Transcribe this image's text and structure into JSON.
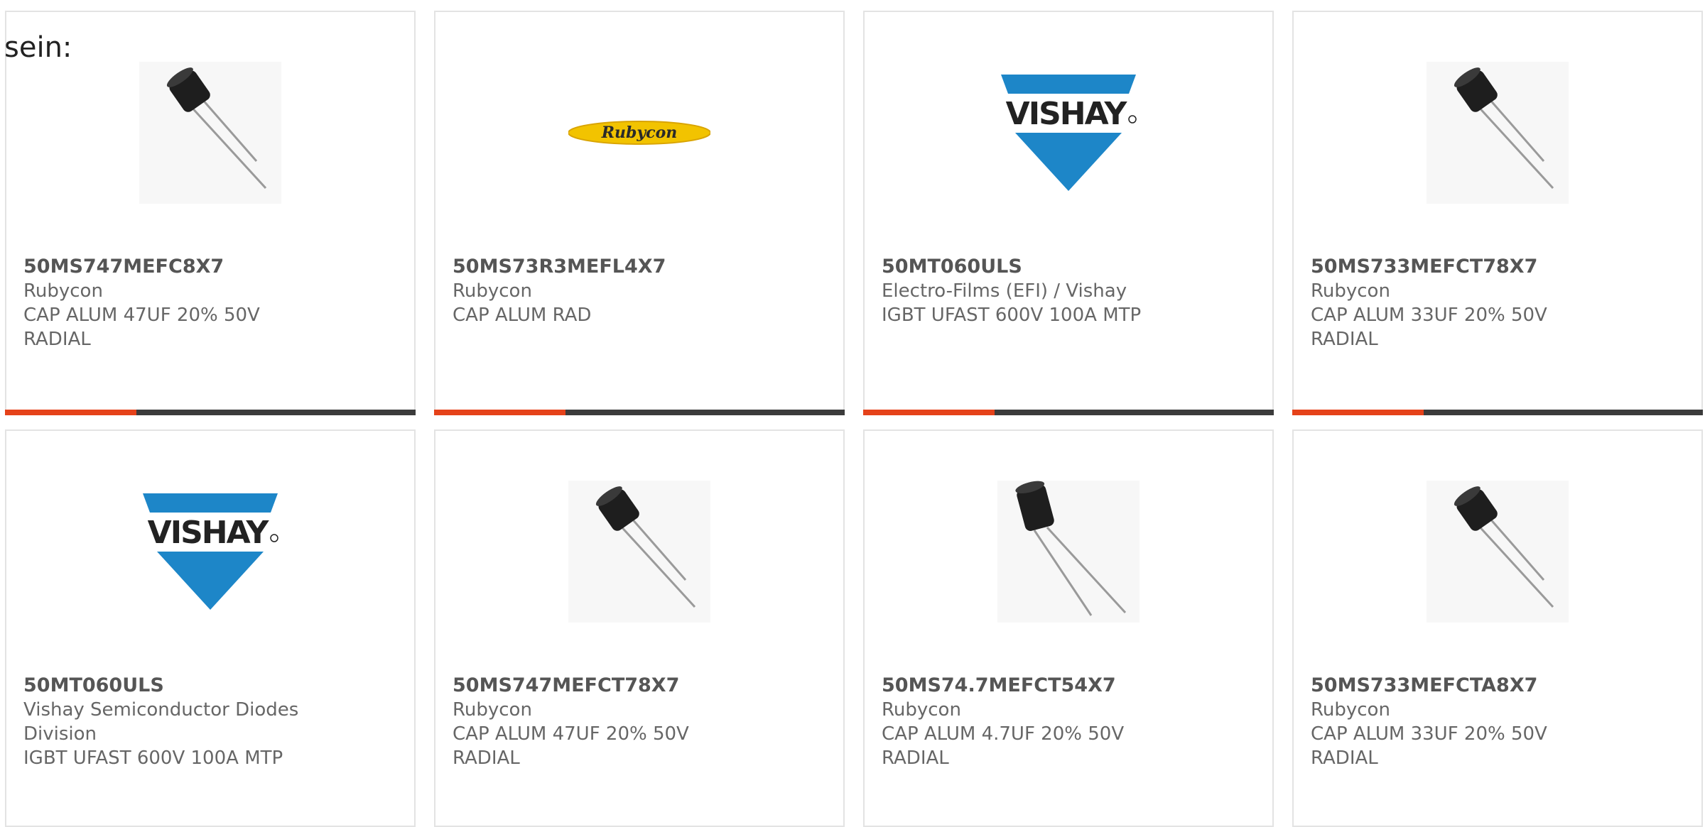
{
  "intro": "sein:",
  "colors": {
    "accent": "#e5421a",
    "bar": "#3b3b3b",
    "vishay_blue": "#1d86c8",
    "rubycon_yellow": "#f2c300"
  },
  "cards": [
    {
      "part": "50MS747MEFC8X7",
      "manufacturer": "Rubycon",
      "desc1": "CAP ALUM 47UF 20% 50V",
      "desc2": "RADIAL",
      "image": "capacitor-photo",
      "progress": 0.32
    },
    {
      "part": "50MS73R3MEFL4X7",
      "manufacturer": "Rubycon",
      "desc1": "CAP ALUM RAD",
      "desc2": "",
      "image": "rubycon-logo",
      "logo_text": "Rubycon",
      "progress": 0.32
    },
    {
      "part": "50MT060ULS",
      "manufacturer": "Electro-Films (EFI) / Vishay",
      "desc1": "IGBT UFAST 600V 100A MTP",
      "desc2": "",
      "image": "vishay-logo",
      "logo_text": "VISHAY",
      "progress": 0.32
    },
    {
      "part": "50MS733MEFCT78X7",
      "manufacturer": "Rubycon",
      "desc1": "CAP ALUM 33UF 20% 50V",
      "desc2": "RADIAL",
      "image": "capacitor-photo",
      "progress": 0.32
    },
    {
      "part": "50MT060ULS",
      "manufacturer": "Vishay Semiconductor Diodes",
      "desc1": "Division",
      "desc2": "IGBT UFAST 600V 100A MTP",
      "image": "vishay-logo",
      "logo_text": "VISHAY",
      "progress": null
    },
    {
      "part": "50MS747MEFCT78X7",
      "manufacturer": "Rubycon",
      "desc1": "CAP ALUM 47UF 20% 50V",
      "desc2": "RADIAL",
      "image": "capacitor-photo",
      "progress": null
    },
    {
      "part": "50MS74.7MEFCT54X7",
      "manufacturer": "Rubycon",
      "desc1": "CAP ALUM 4.7UF 20% 50V",
      "desc2": "RADIAL",
      "image": "capacitor-photo-upright",
      "progress": null
    },
    {
      "part": "50MS733MEFCTA8X7",
      "manufacturer": "Rubycon",
      "desc1": "CAP ALUM 33UF 20% 50V",
      "desc2": "RADIAL",
      "image": "capacitor-photo",
      "progress": null
    }
  ]
}
